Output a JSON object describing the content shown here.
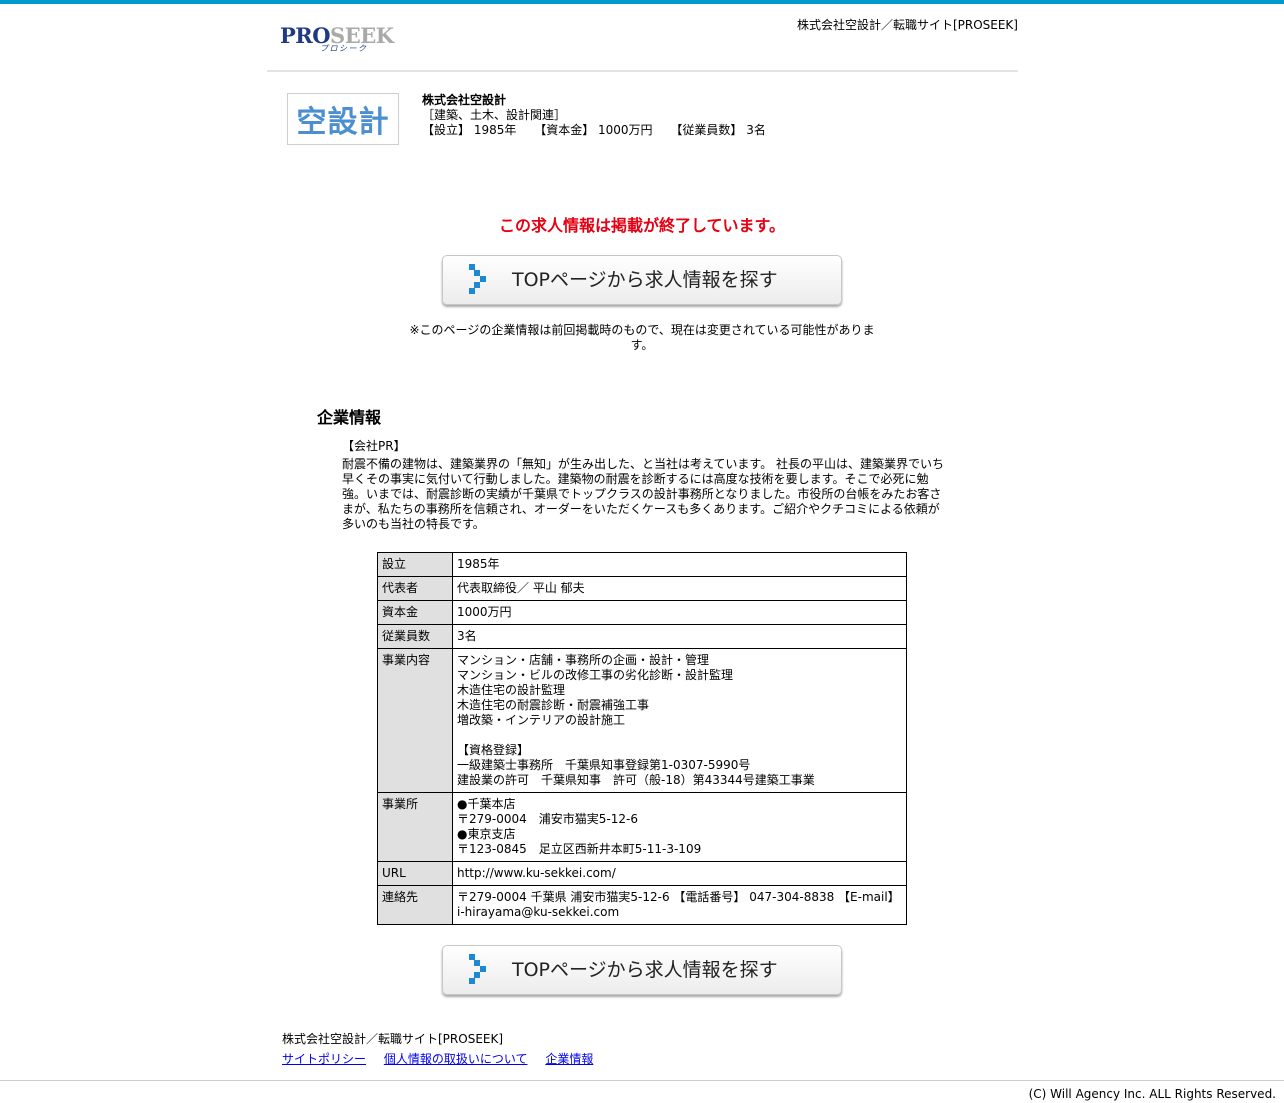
{
  "header": {
    "logo_text_a": "PRO",
    "logo_text_b": "SEEK",
    "logo_sub": "プロシーク",
    "site_title": "株式会社空設計／転職サイト[PROSEEK]"
  },
  "company": {
    "logo_text": "空設計",
    "name": "株式会社空設計",
    "category": "［建築、土木、設計関連］",
    "facts": [
      "【設立】 1985年",
      "【資本金】 1000万円",
      "【従業員数】 3名"
    ]
  },
  "notice": {
    "ended": "この求人情報は掲載が終了しています。",
    "button_label": "TOPページから求人情報を探す",
    "note": "※このページの企業情報は前回掲載時のもので、現在は変更されている可能性があります。"
  },
  "company_info": {
    "title": "企業情報",
    "pr_label": "【会社PR】",
    "pr_text": "耐震不備の建物は、建築業界の「無知」が生み出した、と当社は考えています。\n社長の平山は、建築業界でいち早くその事実に気付いて行動しました。建築物の耐震を診断するには高度な技術を要します。そこで必死に勉強。いまでは、耐震診断の実績が千葉県でトップクラスの設計事務所となりました。市役所の台帳をみたお客さまが、私たちの事務所を信頼され、オーダーをいただくケースも多くあります。ご紹介やクチコミによる依頼が多いのも当社の特長です。",
    "rows": [
      {
        "label": "設立",
        "value": "1985年"
      },
      {
        "label": "代表者",
        "value": "代表取締役／ 平山 郁夫"
      },
      {
        "label": "資本金",
        "value": "1000万円"
      },
      {
        "label": "従業員数",
        "value": "3名"
      },
      {
        "label": "事業内容",
        "value": "マンション・店舗・事務所の企画・設計・管理\nマンション・ビルの改修工事の劣化診断・設計監理\n木造住宅の設計監理\n木造住宅の耐震診断・耐震補強工事\n増改築・インテリアの設計施工\n\n【資格登録】\n一級建築士事務所　千葉県知事登録第1-0307-5990号\n建設業の許可　千葉県知事　許可（般-18）第43344号建築工事業"
      },
      {
        "label": "事業所",
        "value": "●千葉本店\n〒279-0004　浦安市猫実5-12-6\n●東京支店\n〒123-0845　足立区西新井本町5-11-3-109"
      },
      {
        "label": "URL",
        "value": "http://www.ku-sekkei.com/"
      },
      {
        "label": "連絡先",
        "value": "〒279-0004 千葉県 浦安市猫実5-12-6 【電話番号】 047-304-8838 【E-mail】 i-hirayama@ku-sekkei.com"
      }
    ]
  },
  "footer": {
    "title": "株式会社空設計／転職サイト[PROSEEK]",
    "links": [
      "サイトポリシー",
      "個人情報の取扱いについて",
      "企業情報"
    ],
    "copyright": "(C) Will Agency Inc. ALL Rights Reserved."
  }
}
